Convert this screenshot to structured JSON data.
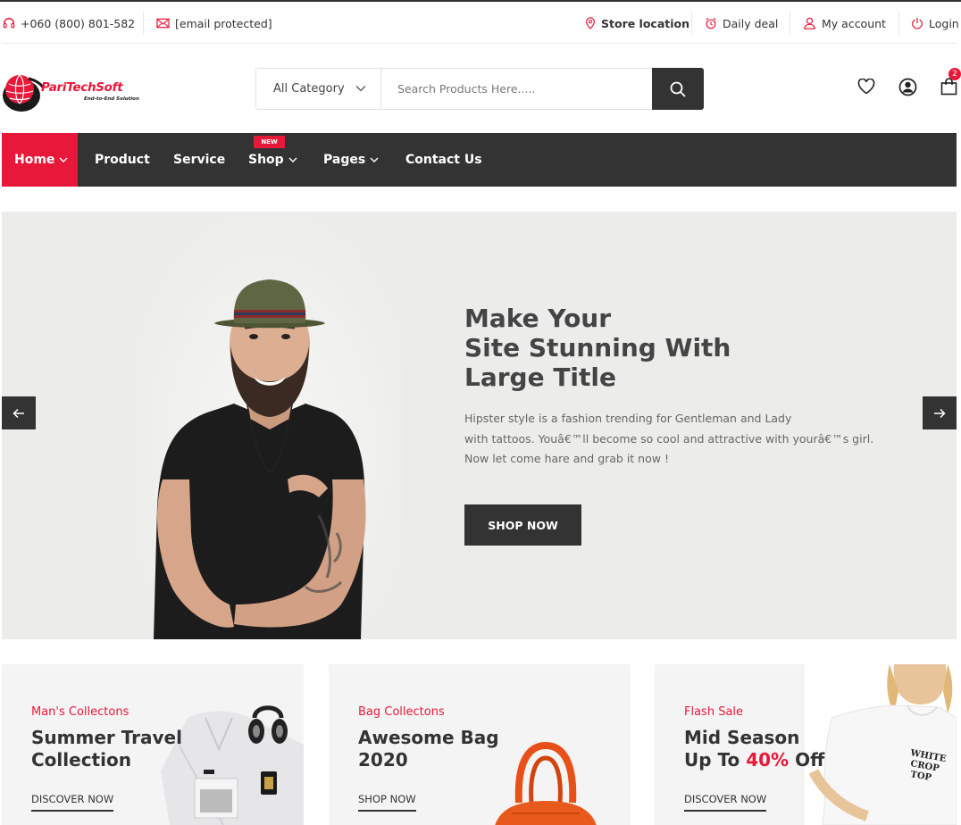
{
  "topbar": {
    "phone": "+060 (800) 801-582",
    "email": "[email protected]",
    "store_location": "Store location",
    "daily_deal": "Daily deal",
    "my_account": "My account",
    "login": "Login"
  },
  "header": {
    "logo_text": "PariTechSoft",
    "logo_tagline": "End-to-End Solution",
    "category_select": "All Category",
    "search_placeholder": "Search Products Here.....",
    "cart_count": "2"
  },
  "nav": {
    "items": [
      {
        "label": "Home"
      },
      {
        "label": "Product"
      },
      {
        "label": "Service"
      },
      {
        "label": "Shop"
      },
      {
        "label": "Pages"
      },
      {
        "label": "Contact Us"
      }
    ],
    "new_badge": "NEW"
  },
  "hero": {
    "title_lines": [
      "Make Your",
      "Site Stunning With",
      "Large Title"
    ],
    "desc_lines": [
      "Hipster style is a fashion trending for Gentleman and Lady",
      "with tattoos. Youâ€™ll become so cool and attractive with yourâ€™s girl.",
      "Now let come hare and grab it now !"
    ],
    "button": "SHOP NOW"
  },
  "banners": [
    {
      "subtitle": "Man's Collectons",
      "title_lines": [
        "Summer Travel",
        "Collection"
      ],
      "link": "DISCOVER NOW"
    },
    {
      "subtitle": "Bag Collectons",
      "title_lines": [
        "Awesome Bag",
        "2020"
      ],
      "link": "SHOP NOW"
    },
    {
      "subtitle": "Flash Sale",
      "title_line1": "Mid Season",
      "title_prefix": "Up To",
      "title_highlight": "40%",
      "title_suffix": "Off",
      "link": "DISCOVER NOW",
      "shirt_text_lines": [
        "WHITE",
        "CROP",
        "TOP"
      ]
    }
  ],
  "colors": {
    "accent": "#e8183a",
    "dark": "#333333",
    "hero_bg": "#ececea",
    "banner_bg": "#f4f4f4"
  }
}
